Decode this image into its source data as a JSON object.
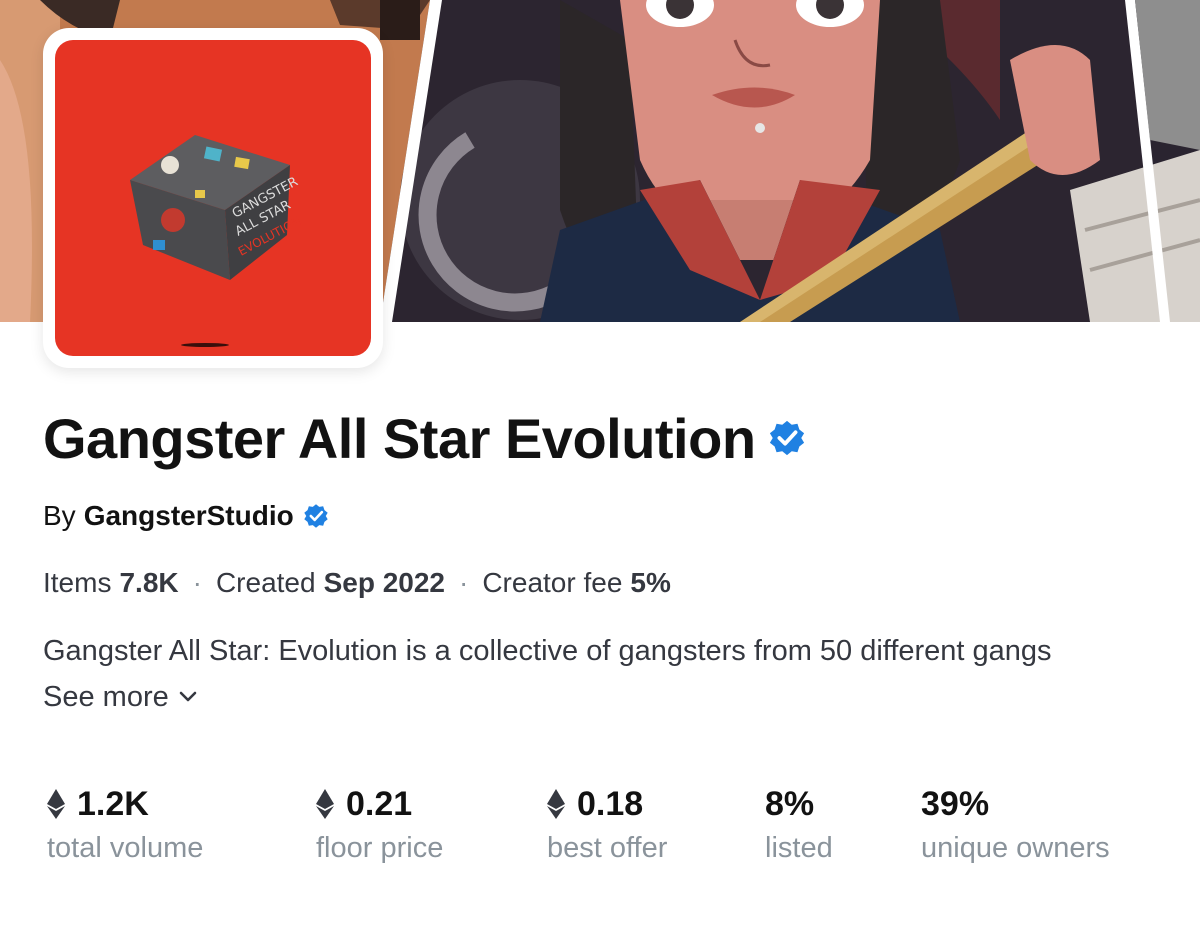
{
  "collection": {
    "title": "Gangster All Star Evolution",
    "verified": true,
    "by_label": "By",
    "creator": "GangsterStudio",
    "creator_verified": true,
    "avatar_text_line1": "GANGSTER",
    "avatar_text_line2": "ALL STAR",
    "avatar_text_line3": "EVOLUTION"
  },
  "meta": {
    "items_label": "Items",
    "items_value": "7.8K",
    "created_label": "Created",
    "created_value": "Sep 2022",
    "fee_label": "Creator fee",
    "fee_value": "5%",
    "separator": "·"
  },
  "description": {
    "text": "Gangster All Star: Evolution is a collective of gangsters from 50 different gangs",
    "see_more": "See more"
  },
  "stats": [
    {
      "value": "1.2K",
      "label": "total volume",
      "icon": "eth-icon"
    },
    {
      "value": "0.21",
      "label": "floor price",
      "icon": "eth-icon"
    },
    {
      "value": "0.18",
      "label": "best offer",
      "icon": "eth-icon"
    },
    {
      "value": "8%",
      "label": "listed",
      "icon": ""
    },
    {
      "value": "39%",
      "label": "unique owners",
      "icon": ""
    }
  ],
  "colors": {
    "accent_verified": "#2081e2",
    "avatar_bg": "#e63424",
    "muted_text": "#8a939b",
    "body_text": "#353840"
  }
}
